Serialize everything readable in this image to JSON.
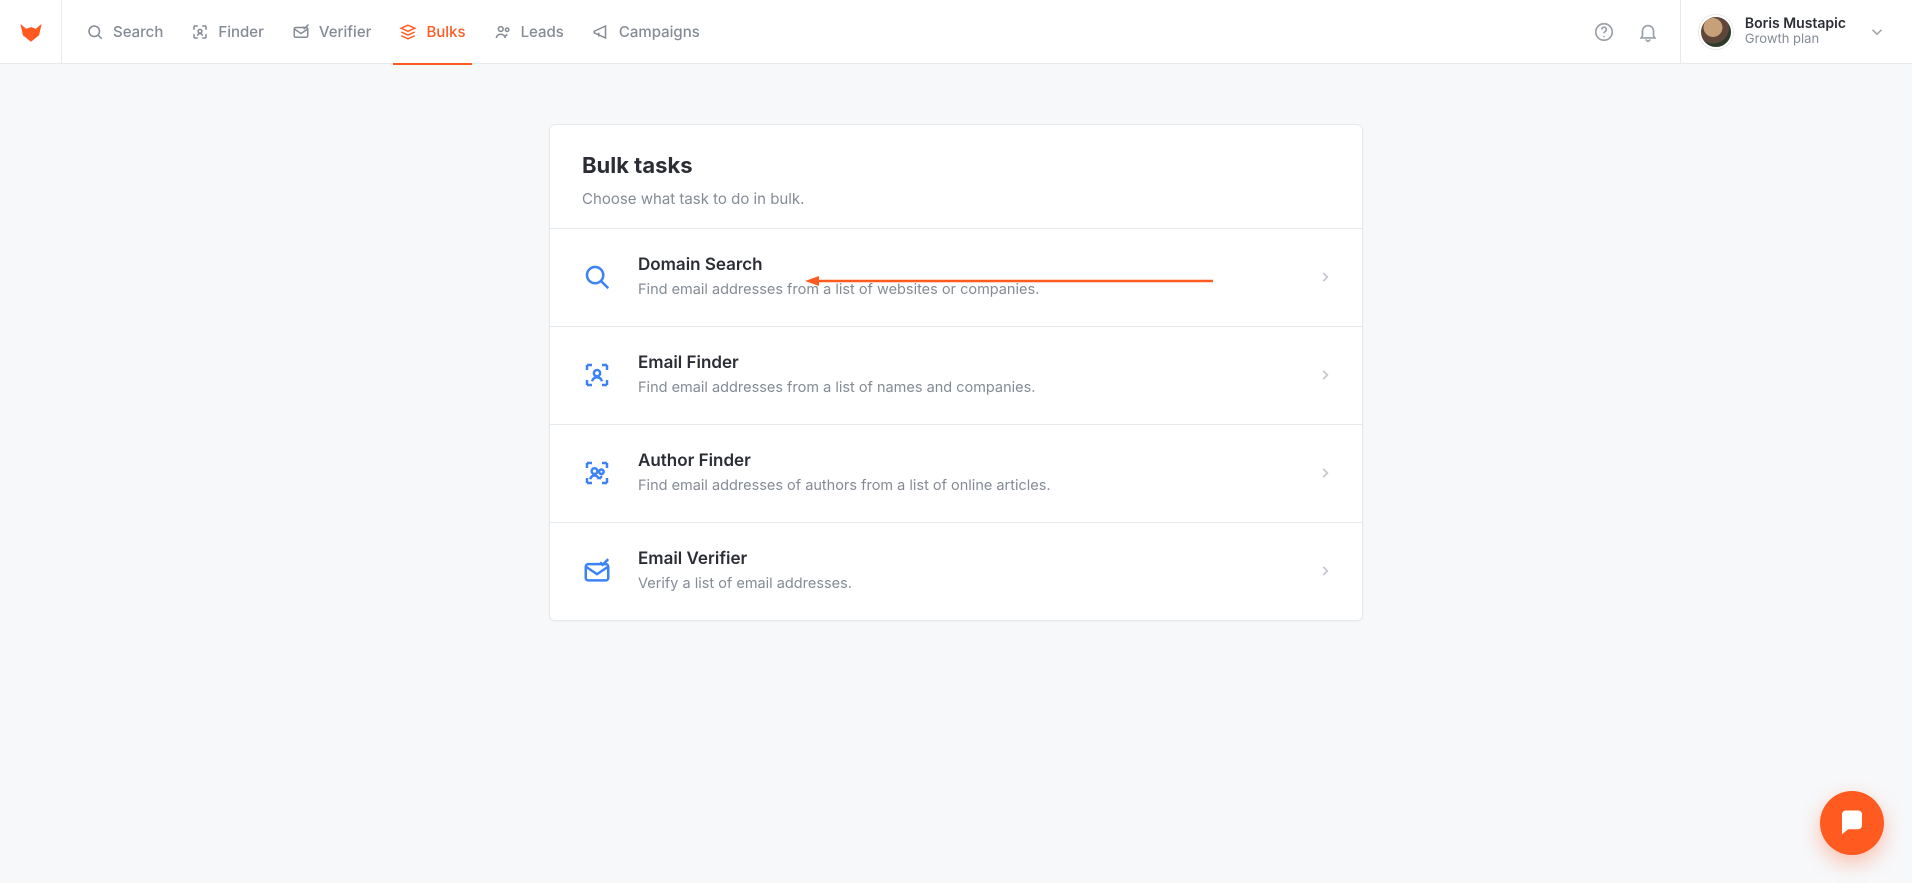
{
  "brand": {
    "logo_name": "fox-logo",
    "accent_color": "#ff5a1f"
  },
  "nav": {
    "items": [
      {
        "id": "search",
        "label": "Search",
        "icon": "search-icon",
        "active": false
      },
      {
        "id": "finder",
        "label": "Finder",
        "icon": "finder-icon",
        "active": false
      },
      {
        "id": "verifier",
        "label": "Verifier",
        "icon": "verifier-icon",
        "active": false
      },
      {
        "id": "bulks",
        "label": "Bulks",
        "icon": "bulks-icon",
        "active": true
      },
      {
        "id": "leads",
        "label": "Leads",
        "icon": "leads-icon",
        "active": false
      },
      {
        "id": "campaigns",
        "label": "Campaigns",
        "icon": "campaign-icon",
        "active": false
      }
    ]
  },
  "header_icons": {
    "help": "help-icon",
    "notifications": "bell-icon"
  },
  "user": {
    "name": "Boris Mustapic",
    "plan": "Growth plan"
  },
  "page": {
    "title": "Bulk tasks",
    "subtitle": "Choose what task to do in bulk."
  },
  "tasks": [
    {
      "id": "domain-search",
      "icon": "search-icon",
      "title": "Domain Search",
      "description": "Find email addresses from a list of websites or companies.",
      "highlighted": true
    },
    {
      "id": "email-finder",
      "icon": "person-scan-icon",
      "title": "Email Finder",
      "description": "Find email addresses from a list of names and companies.",
      "highlighted": false
    },
    {
      "id": "author-finder",
      "icon": "people-scan-icon",
      "title": "Author Finder",
      "description": "Find email addresses of authors from a list of online articles.",
      "highlighted": false
    },
    {
      "id": "email-verifier",
      "icon": "mail-check-icon",
      "title": "Email Verifier",
      "description": "Verify a list of email addresses.",
      "highlighted": false
    }
  ],
  "annotation": {
    "target_task_id": "domain-search",
    "arrow_color": "#ff5a1f"
  },
  "fab": {
    "icon": "chat-icon",
    "color": "#ff5a1f"
  }
}
